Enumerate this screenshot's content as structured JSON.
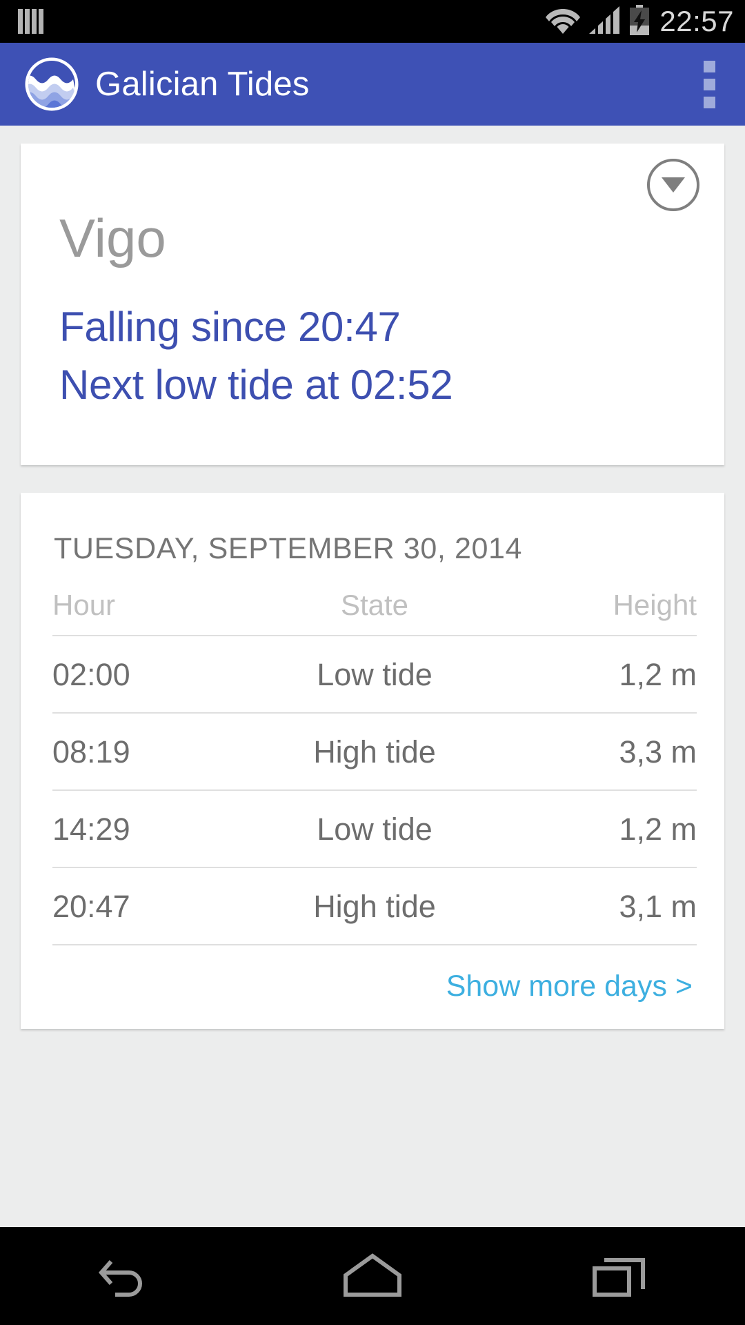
{
  "status_bar": {
    "time": "22:57",
    "icons": {
      "sim": "sim-card-icon",
      "wifi": "wifi-icon",
      "signal": "cellular-signal-icon",
      "battery": "battery-charging-icon"
    }
  },
  "app_bar": {
    "title": "Galician Tides",
    "logo_icon": "wave-circle-logo-icon",
    "overflow_icon": "overflow-menu-icon",
    "background_color": "#3e51b5"
  },
  "current_card": {
    "location": "Vigo",
    "dropdown_icon": "chevron-down-circle-icon",
    "status_lines": [
      "Falling since 20:47",
      "Next low tide at 02:52"
    ],
    "accent_color": "#3d4fb0"
  },
  "day_card": {
    "date": "TUESDAY, SEPTEMBER 30, 2014",
    "columns": [
      "Hour",
      "State",
      "Height"
    ],
    "rows": [
      {
        "hour": "02:00",
        "state": "Low tide",
        "height": "1,2 m"
      },
      {
        "hour": "08:19",
        "state": "High tide",
        "height": "3,3 m"
      },
      {
        "hour": "14:29",
        "state": "Low tide",
        "height": "1,2 m"
      },
      {
        "hour": "20:47",
        "state": "High tide",
        "height": "3,1 m"
      }
    ],
    "show_more_label": "Show more days >",
    "link_color": "#3dafe0"
  },
  "nav_bar": {
    "back_icon": "back-arrow-icon",
    "home_icon": "home-icon",
    "recents_icon": "recent-apps-icon"
  }
}
